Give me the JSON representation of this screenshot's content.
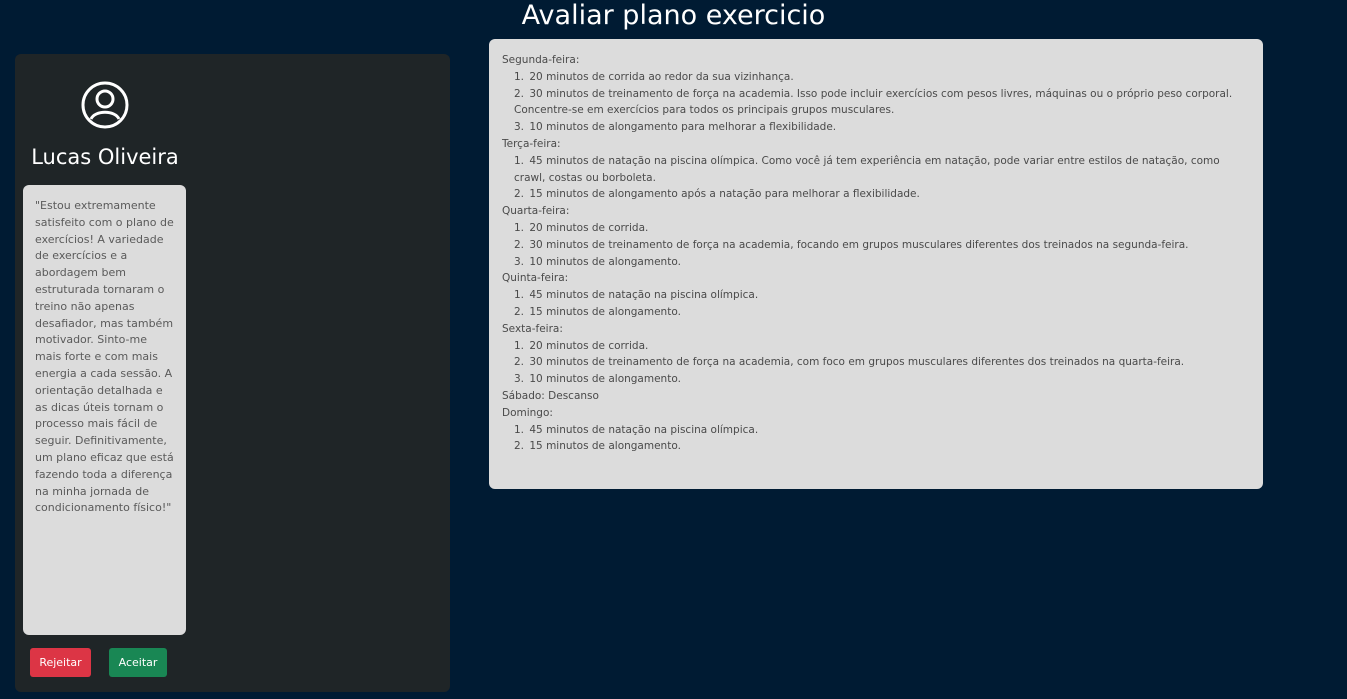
{
  "page": {
    "title": "Avaliar plano exercicio"
  },
  "profile": {
    "icon": "user-circle-icon",
    "name": "Lucas Oliveira",
    "comment": "\"Estou extremamente satisfeito com o plano de exercícios! A variedade de exercícios e a abordagem bem estruturada tornaram o treino não apenas desafiador, mas também motivador. Sinto-me mais forte e com mais energia a cada sessão. A orientação detalhada e as dicas úteis tornam o processo mais fácil de seguir. Definitivamente, um plano eficaz que está fazendo toda a diferença na minha jornada de condicionamento físico!\"",
    "reject_label": "Rejeitar",
    "accept_label": "Aceitar"
  },
  "plan": {
    "days": [
      {
        "name": "Segunda-feira:",
        "items": [
          "20 minutos de corrida ao redor da sua vizinhança.",
          "30 minutos de treinamento de força na academia. Isso pode incluir exercícios com pesos livres, máquinas ou o próprio peso corporal. Concentre-se em exercícios para todos os principais grupos musculares.",
          "10 minutos de alongamento para melhorar a flexibilidade."
        ]
      },
      {
        "name": "Terça-feira:",
        "items": [
          "45 minutos de natação na piscina olímpica. Como você já tem experiência em natação, pode variar entre estilos de natação, como crawl, costas ou borboleta.",
          "15 minutos de alongamento após a natação para melhorar a flexibilidade."
        ]
      },
      {
        "name": "Quarta-feira:",
        "items": [
          "20 minutos de corrida.",
          "30 minutos de treinamento de força na academia, focando em grupos musculares diferentes dos treinados na segunda-feira.",
          "10 minutos de alongamento."
        ]
      },
      {
        "name": "Quinta-feira:",
        "items": [
          "45 minutos de natação na piscina olímpica.",
          "15 minutos de alongamento."
        ]
      },
      {
        "name": "Sexta-feira:",
        "items": [
          "20 minutos de corrida.",
          "30 minutos de treinamento de força na academia, com foco em grupos musculares diferentes dos treinados na quarta-feira.",
          "10 minutos de alongamento."
        ]
      },
      {
        "name": "Sábado: Descanso",
        "items": []
      },
      {
        "name": "Domingo:",
        "items": [
          "45 minutos de natação na piscina olímpica.",
          "15 minutos de alongamento."
        ]
      }
    ]
  }
}
